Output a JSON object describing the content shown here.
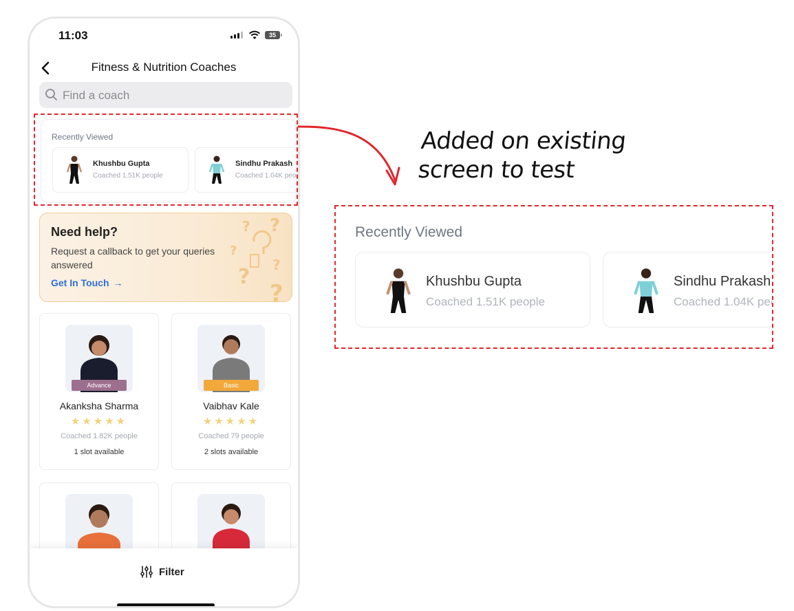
{
  "status_bar": {
    "time": "11:03",
    "battery": "35"
  },
  "header": {
    "title": "Fitness & Nutrition Coaches"
  },
  "search": {
    "placeholder": "Find a coach"
  },
  "recently_viewed": {
    "label": "Recently Viewed",
    "items": [
      {
        "name": "Khushbu Gupta",
        "coached": "Coached 1.51K people",
        "outfit": "#111111"
      },
      {
        "name": "Sindhu Prakash",
        "coached": "Coached 1.04K people",
        "outfit": "#7fd0d6"
      }
    ]
  },
  "help_banner": {
    "title": "Need help?",
    "description": "Request a callback to get your queries answered",
    "cta": "Get In Touch"
  },
  "coaches": [
    {
      "name": "Akanksha Sharma",
      "level": "Advance",
      "level_color": "#9c6f8e",
      "rating": 5,
      "coached": "Coached 1.82K people",
      "slots": "1 slot available",
      "shirt": "#1a1d2e"
    },
    {
      "name": "Vaibhav Kale",
      "level": "Basic",
      "level_color": "#f2a83b",
      "rating": 5,
      "coached": "Coached 79 people",
      "slots": "2 slots available",
      "shirt": "#7a7a7a"
    },
    {
      "name": "",
      "shirt": "#e8703a"
    },
    {
      "name": "",
      "shirt": "#d62a3b"
    }
  ],
  "filter": {
    "label": "Filter"
  },
  "annotation": {
    "line1": "Added on existing",
    "line2": "screen to test"
  },
  "colors": {
    "accent_link": "#2f6fd6",
    "annotation_red": "#e0262b",
    "star": "#f4d27a"
  }
}
